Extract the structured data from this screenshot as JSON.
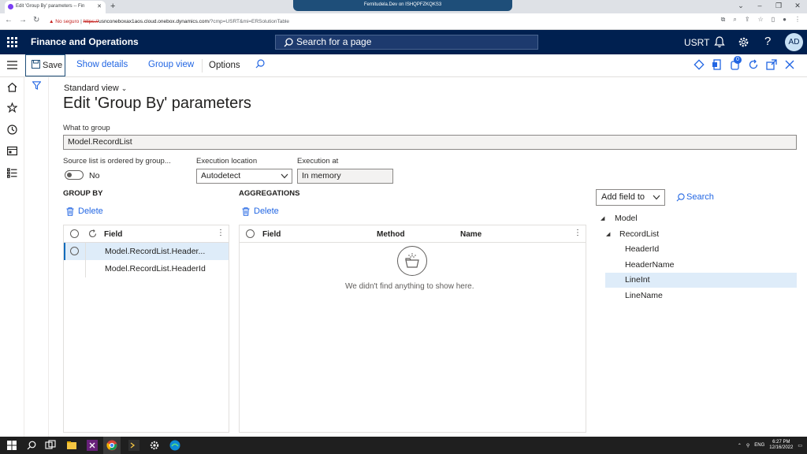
{
  "browser": {
    "tab_title": "Edit 'Group By' parameters -- Fin",
    "remote_title": "Fernitudela.Dev on ISHQPFZKQKS3",
    "url_warning": "No seguro",
    "url_scheme": "https://",
    "url_host": "usnconeboxax1aos.cloud.onebox.dynamics.com",
    "url_path": "/?cmp=USRT&mi=ERSolutionTable"
  },
  "header": {
    "app_name": "Finance and Operations",
    "search_placeholder": "Search for a page",
    "company": "USRT",
    "help": "?",
    "avatar_initials": "AD"
  },
  "actions": {
    "save": "Save",
    "show_details": "Show details",
    "group_view": "Group view",
    "options": "Options",
    "badge_count": "0"
  },
  "page": {
    "view_name": "Standard view",
    "title": "Edit 'Group By' parameters",
    "what_to_group_label": "What to group",
    "what_to_group_value": "Model.RecordList",
    "sorted_label": "Source list is ordered by group...",
    "sorted_value": "No",
    "exec_location_label": "Execution location",
    "exec_location_value": "Autodetect",
    "exec_at_label": "Execution at",
    "exec_at_value": "In memory"
  },
  "group_by": {
    "heading": "GROUP BY",
    "delete": "Delete",
    "column": "Field",
    "rows": [
      "Model.RecordList.Header...",
      "Model.RecordList.HeaderId"
    ]
  },
  "aggregations": {
    "heading": "AGGREGATIONS",
    "delete": "Delete",
    "columns": [
      "Field",
      "Method",
      "Name"
    ],
    "empty_message": "We didn't find anything to show here."
  },
  "tree": {
    "add_field": "Add field to",
    "search": "Search",
    "root": "Model",
    "child": "RecordList",
    "leaves": [
      "HeaderId",
      "HeaderName",
      "LineInt",
      "LineName"
    ]
  },
  "taskbar": {
    "lang": "ENG",
    "time": "6:27 PM",
    "date": "12/16/2022"
  }
}
